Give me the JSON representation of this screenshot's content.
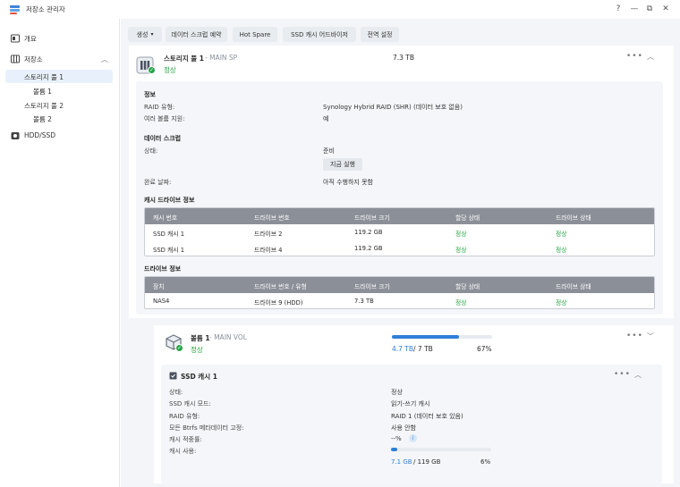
{
  "window": {
    "title": "저장소 관리자",
    "controls": [
      "?",
      "—",
      "⧉",
      "✕"
    ]
  },
  "sidebar": {
    "items": [
      {
        "label": "개요",
        "icon": "overview-icon"
      },
      {
        "label": "저장소",
        "icon": "storage-icon"
      },
      {
        "label": "HDD/SSD",
        "icon": "hdd-icon"
      }
    ],
    "sub_items": [
      {
        "label": "스토리지 풀 1"
      },
      {
        "label": "볼륨 1"
      },
      {
        "label": "스토리지 풀 2"
      },
      {
        "label": "볼륨 2"
      }
    ]
  },
  "toolbar": {
    "create": "생성",
    "scrub_schedule": "데이터 스크럽 예약",
    "hot_spare": "Hot Spare",
    "ssd_advisor": "SSD 캐시 어드바이저",
    "global_settings": "전역 설정"
  },
  "pool": {
    "name": "스토리지 풀 1",
    "subname": " - MAIN SP",
    "status": "정상",
    "size": "7.3 TB",
    "info_title": "정보",
    "raid_type_label": "RAID 유형:",
    "raid_type_value": "Synology Hybrid RAID (SHR) (데이터 보호 없음)",
    "multi_volume_label": "여러 볼륨 지원:",
    "multi_volume_value": "예",
    "scrub_title": "데이터 스크럽",
    "state_label": "상태:",
    "state_value": "준비",
    "run_now": "지금 실행",
    "completed_label": "완료 날짜:",
    "completed_value": "아직 수행하지 못함",
    "cache_table_title": "캐시 드라이브 정보",
    "cache_table_headers": [
      "캐시 번호",
      "드라이브 번호",
      "드라이브 크기",
      "할당 상태",
      "드라이브 상태"
    ],
    "cache_rows": [
      [
        "SSD 캐시 1",
        "드라이브 2",
        "119.2 GB",
        "정상",
        "정상"
      ],
      [
        "SSD 캐시 1",
        "드라이브 4",
        "119.2 GB",
        "정상",
        "정상"
      ]
    ],
    "drive_table_title": "드라이브 정보",
    "drive_table_headers": [
      "장치",
      "드라이브 번호 / 유형",
      "드라이브 크기",
      "할당 상태",
      "드라이브 상태"
    ],
    "drive_rows": [
      [
        "NAS4",
        "드라이브 9 (HDD)",
        "7.3 TB",
        "정상",
        "정상"
      ]
    ]
  },
  "volume": {
    "name": "볼륨 1",
    "subname": " - MAIN VOL",
    "status": "정상",
    "used": "4.7 TB",
    "total": " / 7 TB",
    "percent": "67%",
    "fill_fraction": 0.67
  },
  "ssd_cache": {
    "name": "SSD 캐시 1",
    "rows": [
      {
        "label": "상태:",
        "value": "정상"
      },
      {
        "label": "SSD 캐시 모드:",
        "value": "읽기-쓰기 캐시"
      },
      {
        "label": "RAID 유형:",
        "value": "RAID 1 (데이터 보호 있음)"
      },
      {
        "label": "모든 Btrfs 메타데이터 고정:",
        "value": "사용 안함"
      },
      {
        "label": "캐시 적중률:",
        "value": "--%"
      },
      {
        "label": "캐시 사용:",
        "value": ""
      }
    ],
    "usage_used": "7.1 GB",
    "usage_total": " / 119 GB",
    "usage_percent": "6%",
    "usage_fraction": 0.06
  }
}
